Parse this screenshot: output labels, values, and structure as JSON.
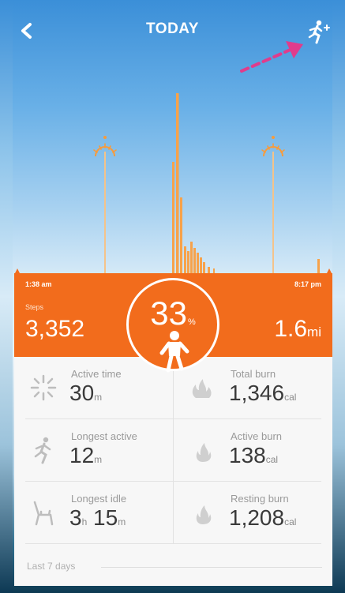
{
  "header": {
    "title": "TODAY",
    "back_icon": "chevron-left-icon",
    "activity_icon": "runner-plus-icon"
  },
  "annotation_color": "#e03c8c",
  "timeline": {
    "start_time": "1:38 am",
    "end_time": "8:17 pm",
    "steps_label": "Steps",
    "steps_value": "3,352",
    "distance_value": "1.6",
    "distance_unit": "mi",
    "goal_percent": "33",
    "goal_percent_sign": "%"
  },
  "stats": [
    {
      "label": "Active time",
      "parts": [
        [
          "30",
          "m"
        ]
      ],
      "icon": "sparkle-icon"
    },
    {
      "label": "Total burn",
      "parts": [
        [
          "1,346",
          "cal"
        ]
      ],
      "icon": "flames-icon"
    },
    {
      "label": "Longest active",
      "parts": [
        [
          "12",
          "m"
        ]
      ],
      "icon": "runner-icon"
    },
    {
      "label": "Active burn",
      "parts": [
        [
          "138",
          "cal"
        ]
      ],
      "icon": "flame-icon"
    },
    {
      "label": "Longest idle",
      "parts": [
        [
          "3",
          "h"
        ],
        [
          "15",
          "m"
        ]
      ],
      "icon": "chair-icon"
    },
    {
      "label": "Resting burn",
      "parts": [
        [
          "1,208",
          "cal"
        ]
      ],
      "icon": "flame-icon"
    }
  ],
  "footer": {
    "last7_label": "Last 7 days"
  },
  "colors": {
    "accent": "#f26c1c",
    "bars": "#f7a24a",
    "panel": "#f7f7f7"
  }
}
